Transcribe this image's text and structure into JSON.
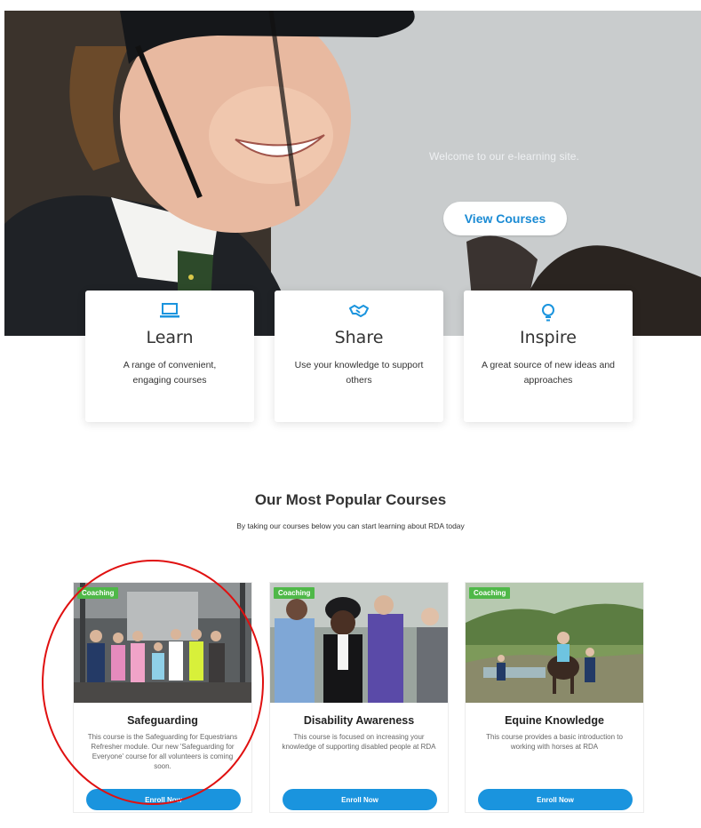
{
  "hero": {
    "welcome_text": "Welcome to our e-learning site.",
    "view_courses_label": "View Courses"
  },
  "features": [
    {
      "icon": "laptop-icon",
      "title": "Learn",
      "description": "A range of convenient, engaging courses"
    },
    {
      "icon": "handshake-icon",
      "title": "Share",
      "description": "Use your knowledge to support others"
    },
    {
      "icon": "lightbulb-icon",
      "title": "Inspire",
      "description": "A great source of new ideas and approaches"
    }
  ],
  "popular": {
    "title": "Our Most Popular Courses",
    "subtitle": "By taking our courses below you can start learning about RDA today"
  },
  "courses": [
    {
      "badge": "Coaching",
      "title": "Safeguarding",
      "description": "This course is the Safeguarding for Equestrians Refresher module. Our new 'Safeguarding for Everyone' course for all volunteers is coming soon.",
      "button": "Enroll Now"
    },
    {
      "badge": "Coaching",
      "title": "Disability Awareness",
      "description": "This course is focused on increasing your knowledge of supporting disabled people at RDA",
      "button": "Enroll Now"
    },
    {
      "badge": "Coaching",
      "title": "Equine Knowledge",
      "description": "This course provides a basic introduction to working with horses at RDA",
      "button": "Enroll Now"
    }
  ],
  "colors": {
    "accent": "#1a94de",
    "badge": "#4fb848",
    "annotation": "#e01010"
  }
}
